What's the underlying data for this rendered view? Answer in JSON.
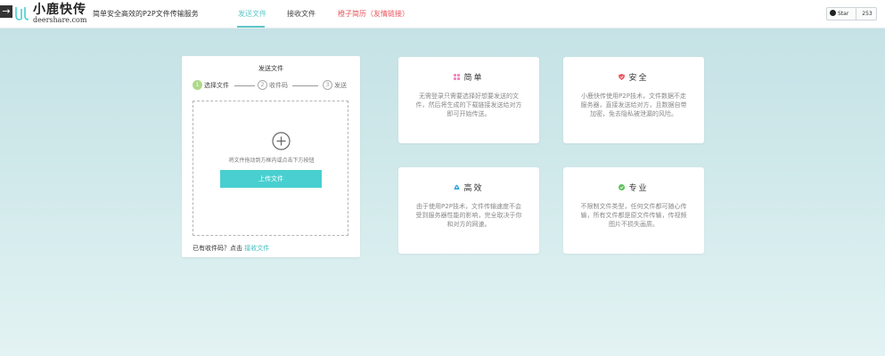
{
  "header": {
    "logo_arrow": "→",
    "logo_cn": "小鹿快传",
    "logo_en": "deershare.com",
    "slogan": "简单安全高效的P2P文件传输服务",
    "nav": {
      "send": "发送文件",
      "receive": "接收文件",
      "resume": "橙子简历（友情链接）"
    },
    "github": {
      "star_label": "Star",
      "count": "253"
    }
  },
  "send_panel": {
    "title": "发送文件",
    "steps": [
      {
        "num": "1",
        "label": "选择文件"
      },
      {
        "num": "2",
        "label": "收件码"
      },
      {
        "num": "3",
        "label": "发送"
      }
    ],
    "drop_hint": "将文件拖动到方框内或点击下方按钮",
    "upload_label": "上传文件",
    "code_hint": "已有收件码？点击",
    "code_link": "接收文件"
  },
  "features": [
    {
      "title": "简单",
      "icon": "grid-icon",
      "color": "#f08bc0",
      "desc": "无需登录只需要选择好想要发送的文件，然后将生成的下载链接发送给对方即可开始传送。"
    },
    {
      "title": "安全",
      "icon": "shield-icon",
      "color": "#e8545c",
      "desc": "小鹿快传使用P2P技术，文件数据不走服务器，直接发送给对方，且数据自带加密，免去隐私被泄漏的风险。"
    },
    {
      "title": "高效",
      "icon": "rocket-icon",
      "color": "#3aa6d8",
      "desc": "由于使用P2P技术，文件传输速度不会受到服务器性能的影响，完全取决于你和对方的网速。"
    },
    {
      "title": "专业",
      "icon": "check-circle-icon",
      "color": "#5cc15c",
      "desc": "不限制文件类型，任何文件都可随心传输，所有文件都是原文件传输，传视频图片不损失画质。"
    }
  ]
}
